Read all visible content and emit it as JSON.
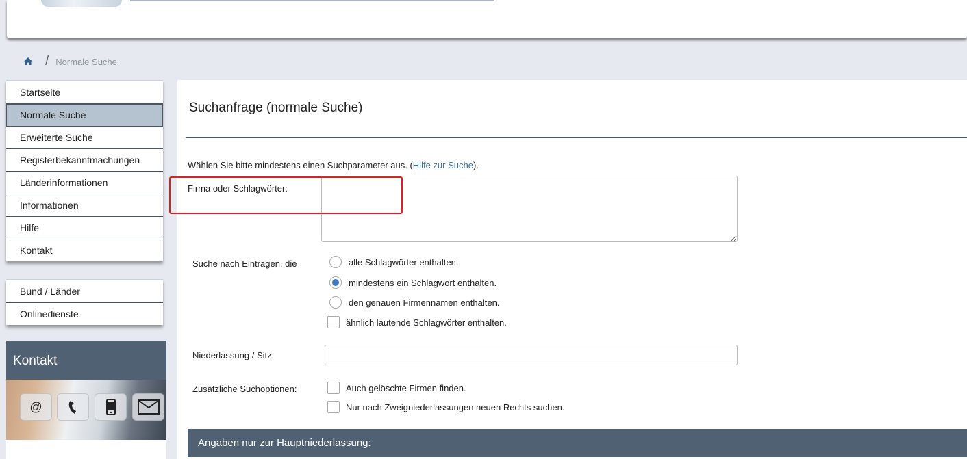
{
  "breadcrumb": {
    "home_icon": "home-icon",
    "separator": "/",
    "current": "Normale Suche"
  },
  "nav_main": [
    {
      "label": "Startseite",
      "active": false
    },
    {
      "label": "Normale Suche",
      "active": true
    },
    {
      "label": "Erweiterte Suche",
      "active": false
    },
    {
      "label": "Registerbekanntmachungen",
      "active": false
    },
    {
      "label": "Länderinformationen",
      "active": false
    },
    {
      "label": "Informationen",
      "active": false
    },
    {
      "label": "Hilfe",
      "active": false
    },
    {
      "label": "Kontakt",
      "active": false
    }
  ],
  "nav_secondary": [
    {
      "label": "Bund / Länder"
    },
    {
      "label": "Onlinedienste"
    }
  ],
  "contact": {
    "title": "Kontakt",
    "icons": [
      "at-icon",
      "phone-icon",
      "mobile-icon",
      "envelope-icon"
    ]
  },
  "form": {
    "title": "Suchanfrage (normale Suche)",
    "intro_text": "Wählen Sie bitte mindestens einen Suchparameter aus. (",
    "intro_link": "Hilfe zur Suche",
    "intro_end": ").",
    "keywords_label": "Firma oder Schlagwörter:",
    "keywords_value": "",
    "search_mode_label": "Suche nach Einträgen, die",
    "search_modes": [
      {
        "label": "alle Schlagwörter enthalten.",
        "selected": false
      },
      {
        "label": "mindestens ein Schlagwort enthalten.",
        "selected": true
      },
      {
        "label": "den genauen Firmennamen enthalten.",
        "selected": false
      }
    ],
    "similar_label": "ähnlich lautende Schlagwörter enthalten.",
    "similar_checked": false,
    "location_label": "Niederlassung / Sitz:",
    "location_value": "",
    "extra_label": "Zusätzliche Suchoptionen:",
    "extra_options": [
      {
        "label": "Auch gelöschte Firmen finden.",
        "checked": false
      },
      {
        "label": "Nur nach Zweigniederlassungen neuen Rechts suchen.",
        "checked": false
      }
    ],
    "section_title": "Angaben nur zur Hauptniederlassung:"
  },
  "colors": {
    "accent": "#4f6172",
    "active_nav": "#b4c3cf",
    "highlight": "#e02020",
    "link": "#3a6fa0"
  }
}
